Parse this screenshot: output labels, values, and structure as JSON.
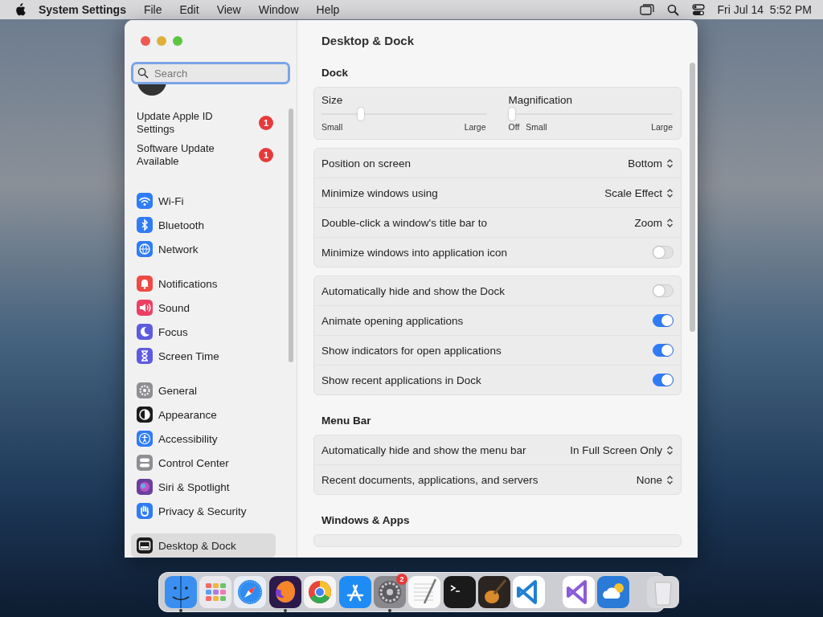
{
  "menu_bar": {
    "app_name": "System Settings",
    "menus": [
      "File",
      "Edit",
      "View",
      "Window",
      "Help"
    ],
    "clock": "Fri Jul 14  5:52 PM"
  },
  "sidebar": {
    "search": {
      "placeholder": "Search"
    },
    "notices": [
      {
        "label": "Update Apple ID Settings",
        "badge": "1"
      },
      {
        "label": "Software Update Available",
        "badge": "1"
      }
    ],
    "groups": [
      [
        {
          "label": "Wi-Fi",
          "kind": "wifi",
          "color": "#2f7cf6",
          "selected": false
        },
        {
          "label": "Bluetooth",
          "kind": "bluetooth",
          "color": "#2f7cf6",
          "selected": false
        },
        {
          "label": "Network",
          "kind": "globe",
          "color": "#2f7cf6",
          "selected": false
        }
      ],
      [
        {
          "label": "Notifications",
          "kind": "bell",
          "color": "#ee4b45",
          "selected": false
        },
        {
          "label": "Sound",
          "kind": "speaker",
          "color": "#ec3f62",
          "selected": false
        },
        {
          "label": "Focus",
          "kind": "moon",
          "color": "#5d5cde",
          "selected": false
        },
        {
          "label": "Screen Time",
          "kind": "hourglass",
          "color": "#5d5cde",
          "selected": false
        }
      ],
      [
        {
          "label": "General",
          "kind": "gear",
          "color": "#8e8e93",
          "selected": false
        },
        {
          "label": "Appearance",
          "kind": "contrast",
          "color": "#1c1c1e",
          "selected": false
        },
        {
          "label": "Accessibility",
          "kind": "person",
          "color": "#2f7cf6",
          "selected": false
        },
        {
          "label": "Control Center",
          "kind": "switches",
          "color": "#8e8e93",
          "selected": false
        },
        {
          "label": "Siri & Spotlight",
          "kind": "orb",
          "color": "#6b3fa0",
          "selected": false
        },
        {
          "label": "Privacy & Security",
          "kind": "hand",
          "color": "#2f7cf6",
          "selected": false
        }
      ],
      [
        {
          "label": "Desktop & Dock",
          "kind": "dock",
          "color": "#1c1c1e",
          "selected": true
        }
      ]
    ]
  },
  "content": {
    "title": "Desktop & Dock",
    "sections": [
      {
        "heading": "Dock",
        "cards": [
          [
            {
              "kind": "sliders",
              "sliders": [
                {
                  "label": "Size",
                  "level": 0.23,
                  "marks": [
                    "Small",
                    "Large"
                  ]
                },
                {
                  "label": "Magnification",
                  "level": 0.0,
                  "marks": [
                    "Off",
                    "Small",
                    "Large"
                  ]
                }
              ]
            }
          ],
          [
            {
              "kind": "popup",
              "label": "Position on screen",
              "value": "Bottom"
            },
            {
              "kind": "popup",
              "label": "Minimize windows using",
              "value": "Scale Effect"
            },
            {
              "kind": "popup",
              "label": "Double-click a window's title bar to",
              "value": "Zoom"
            },
            {
              "kind": "toggle",
              "label": "Minimize windows into application icon",
              "on": false
            }
          ],
          [
            {
              "kind": "toggle",
              "label": "Automatically hide and show the Dock",
              "on": false
            },
            {
              "kind": "toggle",
              "label": "Animate opening applications",
              "on": true
            },
            {
              "kind": "toggle",
              "label": "Show indicators for open applications",
              "on": true
            },
            {
              "kind": "toggle",
              "label": "Show recent applications in Dock",
              "on": true
            }
          ]
        ]
      },
      {
        "heading": "Menu Bar",
        "cards": [
          [
            {
              "kind": "popup",
              "label": "Automatically hide and show the menu bar",
              "value": "In Full Screen Only"
            },
            {
              "kind": "popup",
              "label": "Recent documents, applications, and servers",
              "value": "None"
            }
          ]
        ]
      },
      {
        "heading": "Windows & Apps",
        "cards": [
          [
            {
              "kind": "cut"
            }
          ]
        ]
      }
    ]
  },
  "dock": {
    "apps": [
      {
        "kind": "face",
        "color": "#3a8ff0",
        "running": true
      },
      {
        "kind": "grid",
        "color": "#e9e9ee",
        "running": false
      },
      {
        "kind": "compass",
        "color": "#e9eef5",
        "running": false
      },
      {
        "kind": "flame",
        "color": "#2b1a4a",
        "running": true
      },
      {
        "kind": "ring",
        "color": "#f4f4f4",
        "running": false
      },
      {
        "kind": "letter",
        "color": "#1f8cf5",
        "running": false
      },
      {
        "kind": "gear",
        "color": "#8a8a8e",
        "running": true,
        "badge": "2"
      },
      {
        "kind": "notepad",
        "color": "#fafafa",
        "running": false
      },
      {
        "kind": "terminal",
        "color": "#1a1a1a",
        "running": false
      },
      {
        "kind": "guitar",
        "color": "#2c2420",
        "running": false
      },
      {
        "kind": "chevron",
        "color": "#ffffff",
        "running": false
      },
      {
        "kind": "separator"
      },
      {
        "kind": "ribbon",
        "color": "#ffffff",
        "running": false
      },
      {
        "kind": "cloud",
        "color": "#2a7ad8",
        "running": false
      },
      {
        "kind": "separator"
      },
      {
        "kind": "trash",
        "color": "#d8d8dc",
        "running": false
      }
    ]
  }
}
